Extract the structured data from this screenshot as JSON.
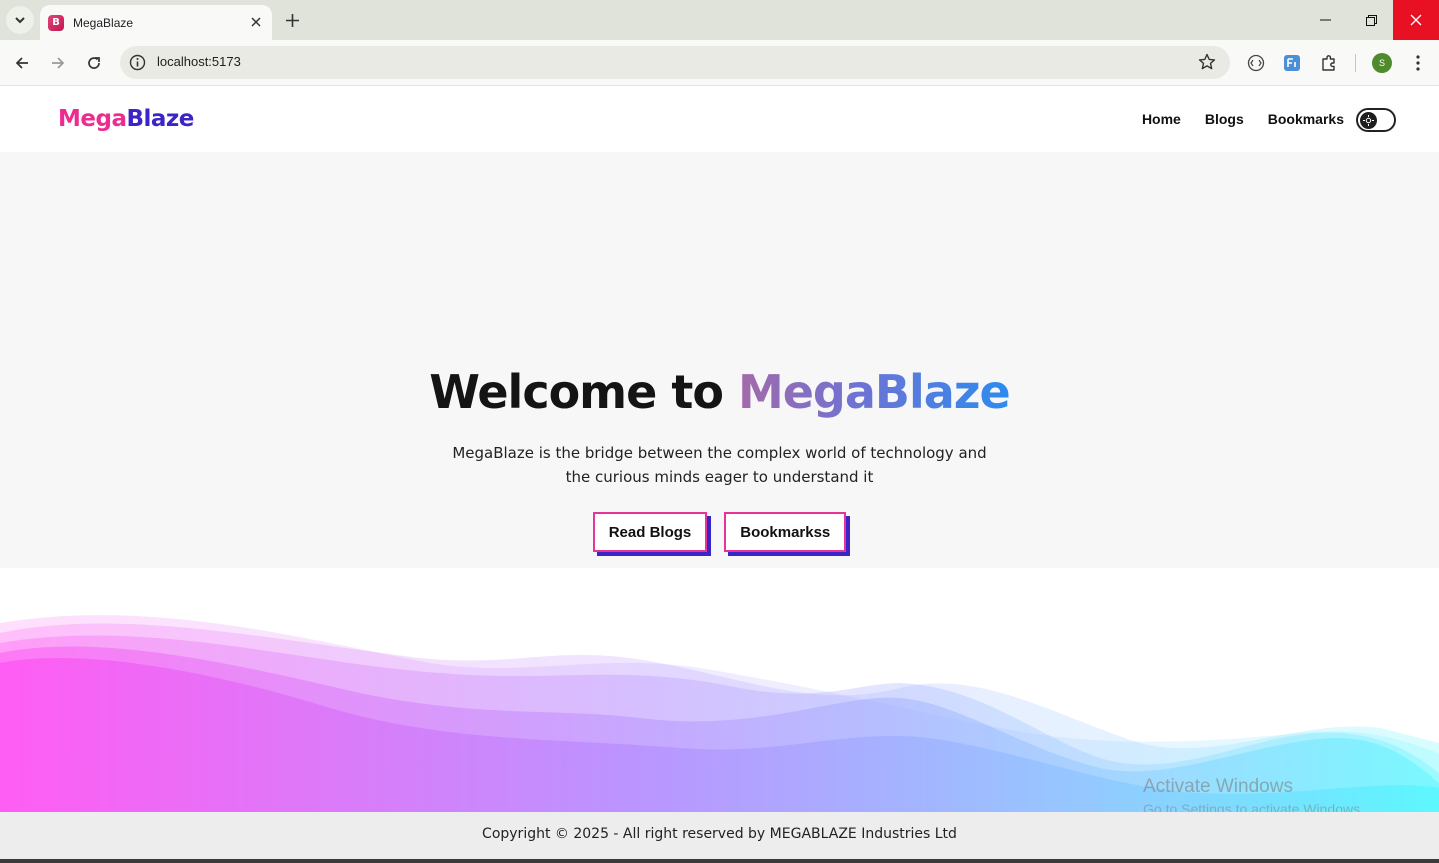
{
  "browser": {
    "tab_title": "MegaBlaze",
    "favicon_letter": "B",
    "url": "localhost:5173",
    "profile_initial": "S",
    "icons": [
      "tab-search-icon",
      "close-icon",
      "new-tab-icon",
      "minimize-icon",
      "restore-icon",
      "window-close-icon",
      "back-icon",
      "forward-icon",
      "reload-icon",
      "site-info-icon",
      "bookmark-star-icon",
      "extension-icon",
      "translate-icon",
      "puzzle-icon",
      "menu-dots-icon"
    ]
  },
  "site": {
    "logo_part1": "Mega",
    "logo_part2": "Blaze",
    "nav": [
      "Home",
      "Blogs",
      "Bookmarks"
    ],
    "theme_toggle_icon": "sun-icon"
  },
  "hero": {
    "title_prefix": "Welcome to ",
    "title_brand": "MegaBlaze",
    "description_line1": "MegaBlaze is the bridge between the complex world of technology and",
    "description_line2": "the curious minds eager to understand it",
    "primary_button": "Read Blogs",
    "secondary_button": "Bookmarkss"
  },
  "footer": {
    "copyright": "Copyright © 2025 - All right reserved by MEGABLAZE Industries Ltd"
  },
  "os_overlay": {
    "title": "Activate Windows",
    "subtitle": "Go to Settings to activate Windows."
  },
  "colors": {
    "brand_pink": "#ec2d8f",
    "brand_purple": "#3b24c8",
    "button_border": "#e8349a",
    "wave_start": "#ff4df2",
    "wave_end": "#4df7ff"
  }
}
